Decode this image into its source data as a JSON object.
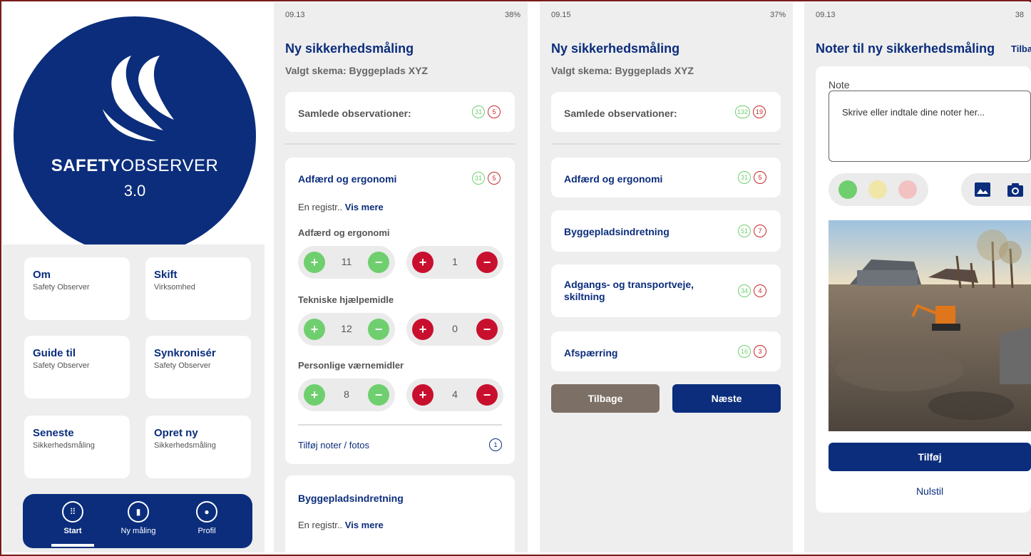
{
  "panel1": {
    "logo": {
      "brand_bold": "SAFETY",
      "brand_light": "OBSERVER",
      "version": "3.0"
    },
    "tiles": [
      {
        "title": "Om",
        "subtitle": "Safety Observer"
      },
      {
        "title": "Skift",
        "subtitle": "Virksomhed"
      },
      {
        "title": "Guide til",
        "subtitle": "Safety Observer"
      },
      {
        "title": "Synkronisér",
        "subtitle": "Safety Observer"
      },
      {
        "title": "Seneste",
        "subtitle": "Sikkerhedsmåling"
      },
      {
        "title": "Opret ny",
        "subtitle": "Sikkerhedsmåling"
      }
    ],
    "nav": [
      {
        "label": "Start",
        "icon": "grid-icon"
      },
      {
        "label": "Ny måling",
        "icon": "clipboard-icon"
      },
      {
        "label": "Profil",
        "icon": "person-icon"
      }
    ]
  },
  "panel2": {
    "status": {
      "time": "09.13",
      "right": "38%"
    },
    "title": "Ny sikkerhedsmåling",
    "subtitle": "Valgt skema: Byggeplads XYZ",
    "summary": {
      "label": "Samlede observationer:",
      "green": "31",
      "red": "5"
    },
    "section1": {
      "title": "Adfærd og ergonomi",
      "green": "31",
      "red": "5",
      "registr": "En registr..",
      "vis_mere": "Vis mere",
      "items": [
        {
          "label": "Adfærd og ergonomi",
          "good": "11",
          "bad": "1"
        },
        {
          "label": "Tekniske hjælpemidle",
          "good": "12",
          "bad": "0"
        },
        {
          "label": "Personlige værnemidler",
          "good": "8",
          "bad": "4"
        }
      ],
      "add_notes": "Tilføj noter / fotos",
      "notes_count": "1"
    },
    "section2": {
      "title": "Byggepladsindretning",
      "registr": "En registr..",
      "vis_mere": "Vis mere"
    }
  },
  "panel3": {
    "status": {
      "time": "09.15",
      "right": "37%"
    },
    "title": "Ny sikkerhedsmåling",
    "subtitle": "Valgt skema: Byggeplads XYZ",
    "summary": {
      "label": "Samlede observationer:",
      "green": "132",
      "red": "19"
    },
    "categories": [
      {
        "title": "Adfærd og ergonomi",
        "green": "31",
        "red": "5"
      },
      {
        "title": "Byggepladsindretning",
        "green": "51",
        "red": "7"
      },
      {
        "title": "Adgangs- og transportveje, skiltning",
        "green": "34",
        "red": "4"
      },
      {
        "title": "Afspærring",
        "green": "16",
        "red": "3"
      }
    ],
    "back": "Tilbage",
    "next": "Næste"
  },
  "panel4": {
    "status": {
      "time": "09.13",
      "right": "38"
    },
    "title": "Noter til ny sikkerhedsmåling",
    "back_link": "Tilba",
    "note_label": "Note",
    "note_placeholder": "Skrive eller indtale dine noter her...",
    "add": "Tilføj",
    "reset": "Nulstil"
  },
  "colors": {
    "brand": "#0b2d7c",
    "good": "#6fcf6f",
    "bad": "#c8102e",
    "back_btn": "#7c7066"
  }
}
